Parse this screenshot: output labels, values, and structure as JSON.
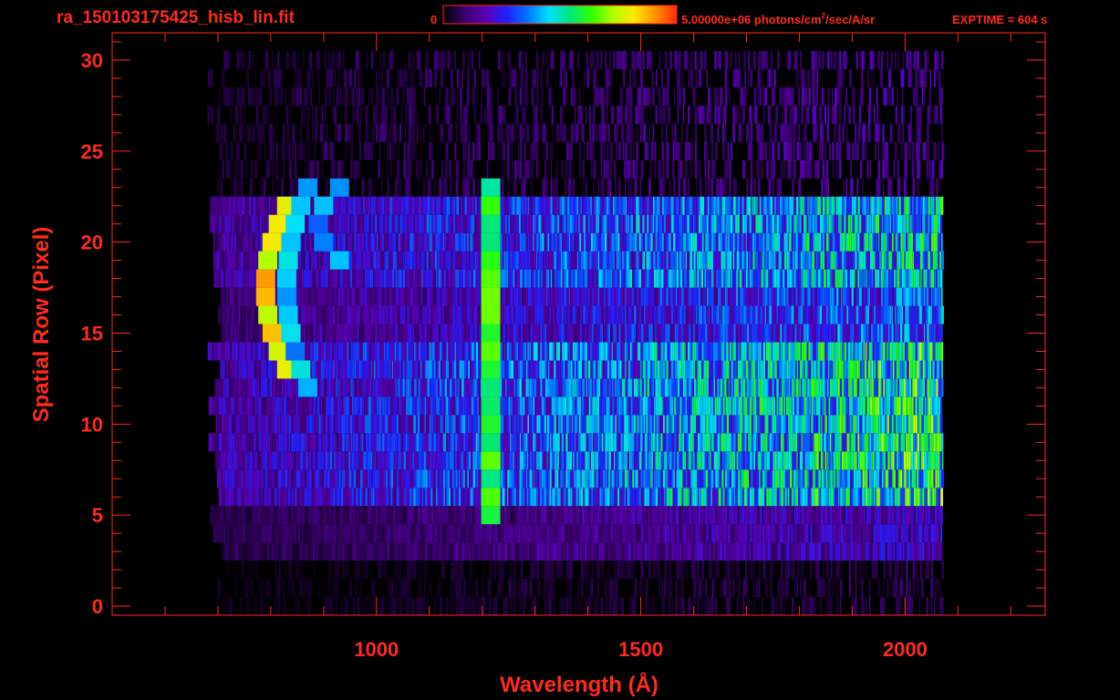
{
  "header": {
    "filename": "ra_150103175425_hisb_lin.fit",
    "exptime": "EXPTIME = 604 s"
  },
  "colorbar": {
    "min_label": "0",
    "max_label": "5.00000e+06 photons/cm",
    "units_superscript": "2",
    "units_suffix": "/sec/A/sr",
    "min_value": 0,
    "max_value": 5000000,
    "colors": [
      "#000000",
      "#3a006e",
      "#5a00b4",
      "#2020ff",
      "#0078ff",
      "#00e0ff",
      "#00e87a",
      "#30ff00",
      "#b0ff00",
      "#ffe800",
      "#ff9000",
      "#ff2a00"
    ]
  },
  "chart_data": {
    "type": "heatmap",
    "title": "ra_150103175425_hisb_lin.fit",
    "xlabel": "Wavelength (Å)",
    "ylabel": "Spatial Row (Pixel)",
    "xlim": [
      500,
      2265
    ],
    "ylim": [
      -0.5,
      31.5
    ],
    "x_ticks": [
      1000,
      1500,
      2000
    ],
    "x_tick_labels": [
      "1000",
      "1500",
      "2000"
    ],
    "x_minor_step": 100,
    "y_ticks": [
      0,
      5,
      10,
      15,
      20,
      25,
      30
    ],
    "y_tick_labels": [
      "0",
      "5",
      "10",
      "15",
      "20",
      "25",
      "30"
    ],
    "y_minor_step": 1,
    "grid": false,
    "legend": "none",
    "colorbar_position": "top",
    "rows": 32,
    "wavelength_coverage": [
      680,
      2070
    ],
    "features": [
      {
        "type": "line",
        "name": "Lyman-alpha",
        "wavelength": 1216,
        "rows": [
          5,
          23
        ],
        "intensity": 0.6
      },
      {
        "type": "arc",
        "wavelength": 830,
        "rows": [
          13,
          22
        ],
        "intensity": 0.85
      },
      {
        "type": "arc",
        "wavelength": 870,
        "rows": [
          12,
          23
        ],
        "intensity": 0.42
      },
      {
        "type": "arc",
        "wavelength": 930,
        "rows": [
          19,
          23
        ],
        "intensity": 0.38
      }
    ],
    "row_profile": [
      {
        "rows": [
          0,
          3
        ],
        "level": 0.05
      },
      {
        "rows": [
          3,
          6
        ],
        "level": 0.13
      },
      {
        "rows": [
          6,
          15
        ],
        "level": 0.34
      },
      {
        "rows": [
          15,
          18
        ],
        "level": 0.22
      },
      {
        "rows": [
          18,
          23
        ],
        "level": 0.3
      },
      {
        "rows": [
          23,
          31
        ],
        "level": 0.1
      }
    ]
  }
}
